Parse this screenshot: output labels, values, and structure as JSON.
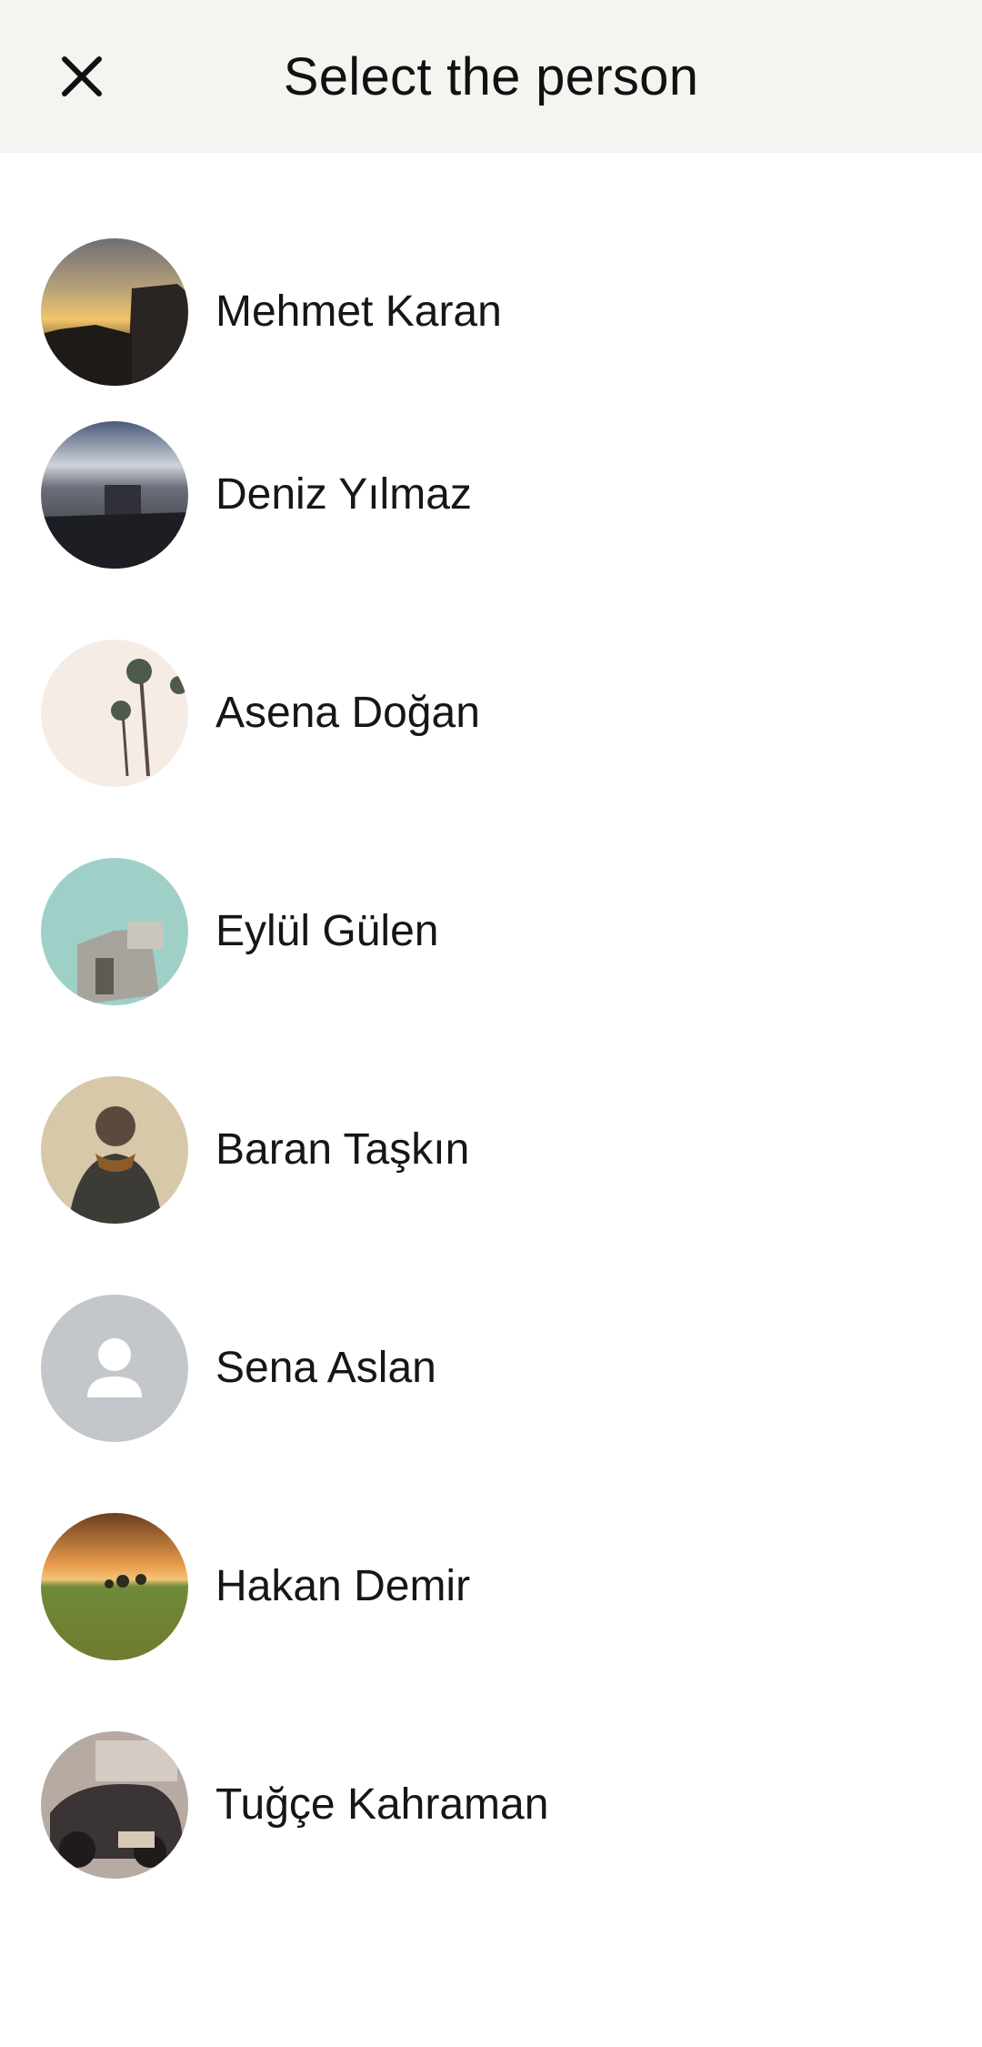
{
  "header": {
    "title": "Select the person",
    "close_icon": "close-icon"
  },
  "contacts": [
    {
      "name": "Mehmet Karan",
      "avatar": "city-sunset-photo"
    },
    {
      "name": "Deniz Yılmaz",
      "avatar": "cloudy-coast-photo"
    },
    {
      "name": "Asena Doğan",
      "avatar": "palm-trees-photo"
    },
    {
      "name": "Eylül Gülen",
      "avatar": "old-building-sky-photo"
    },
    {
      "name": "Baran Taşkın",
      "avatar": "person-back-photo"
    },
    {
      "name": "Sena Aslan",
      "avatar": "default-person-icon"
    },
    {
      "name": "Hakan Demir",
      "avatar": "field-sunset-photo"
    },
    {
      "name": "Tuğçe Kahraman",
      "avatar": "vintage-car-photo"
    }
  ],
  "colors": {
    "header_bg": "#f4f5f1",
    "default_avatar_bg": "#c3c7cc"
  }
}
